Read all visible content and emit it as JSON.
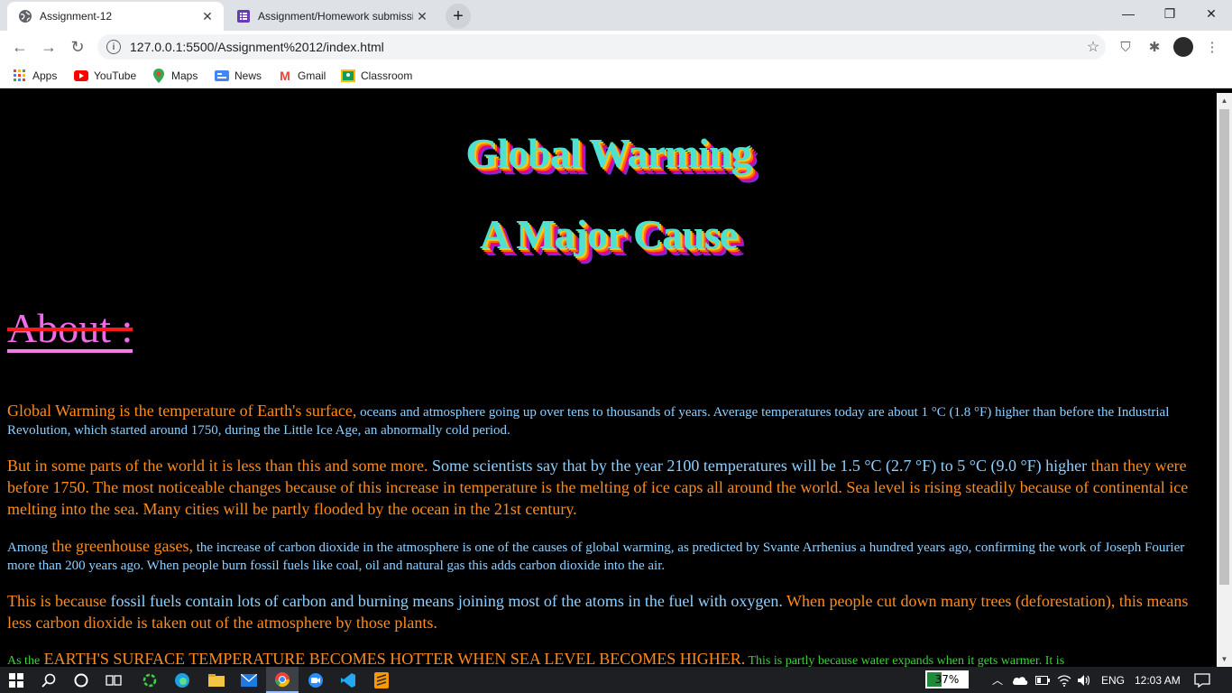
{
  "browser": {
    "tabs": [
      {
        "title": "Assignment-12",
        "active": true
      },
      {
        "title": "Assignment/Homework submissi",
        "active": false
      }
    ],
    "url": "127.0.0.1:5500/Assignment%2012/index.html",
    "bookmarks": [
      "Apps",
      "YouTube",
      "Maps",
      "News",
      "Gmail",
      "Classroom"
    ]
  },
  "page": {
    "headline1": "Global Warming",
    "headline2": "A Major Cause",
    "about": "About :",
    "p1": {
      "a": "Global Warming is the temperature of Earth's surface,",
      "b": " oceans and atmosphere going up over tens to thousands of years. Average temperatures today are about 1 °C (1.8 °F) higher than before the Industrial Revolution, which started around 1750, during the Little Ice Age, an abnormally cold period."
    },
    "p2": {
      "a": "But in some parts of the world it is less than this and some more.",
      "b": " Some scientists say that by the year 2100 temperatures will be 1.5 °C (2.7 °F) to 5 °C (9.0 °F) higher",
      "c": " than they were before 1750. The most noticeable changes because of this increase in temperature is the melting of ice caps all around the world. Sea level is rising steadily because of continental ice melting into the sea. Many cities will be partly flooded by the ocean in the 21st century."
    },
    "p3": {
      "a": "Among",
      "b": " the greenhouse gases,",
      "c": " the increase of carbon dioxide in the atmosphere is one of the causes of global warming, as predicted by Svante Arrhenius a hundred years ago, confirming the work of Joseph Fourier more than 200 years ago. When people burn fossil fuels like coal, oil and natural gas this adds carbon dioxide into the air."
    },
    "p4": {
      "a": "This is because",
      "b": " fossil fuels contain lots of carbon and burning means joining most of the atoms in the fuel with oxygen.",
      "c": " When people cut down many trees (deforestation), this means less carbon dioxide is taken out of the atmosphere by those plants."
    },
    "p5": {
      "a": "As the",
      "b": " EARTH'S SURFACE TEMPERATURE BECOMES HOTTER WHEN SEA LEVEL BECOMES HIGHER.",
      "c": " This is partly because water expands when it gets warmer. It is"
    }
  },
  "taskbar": {
    "battery_percent": "37%",
    "battery_level": 0.37,
    "language": "ENG",
    "time": "12:03 AM"
  },
  "colors": {
    "headline": "#4ee0d0",
    "about": "#f06be8",
    "orange": "#ff8c1a",
    "blue": "#8fd0ff",
    "green": "#3cd23c"
  }
}
